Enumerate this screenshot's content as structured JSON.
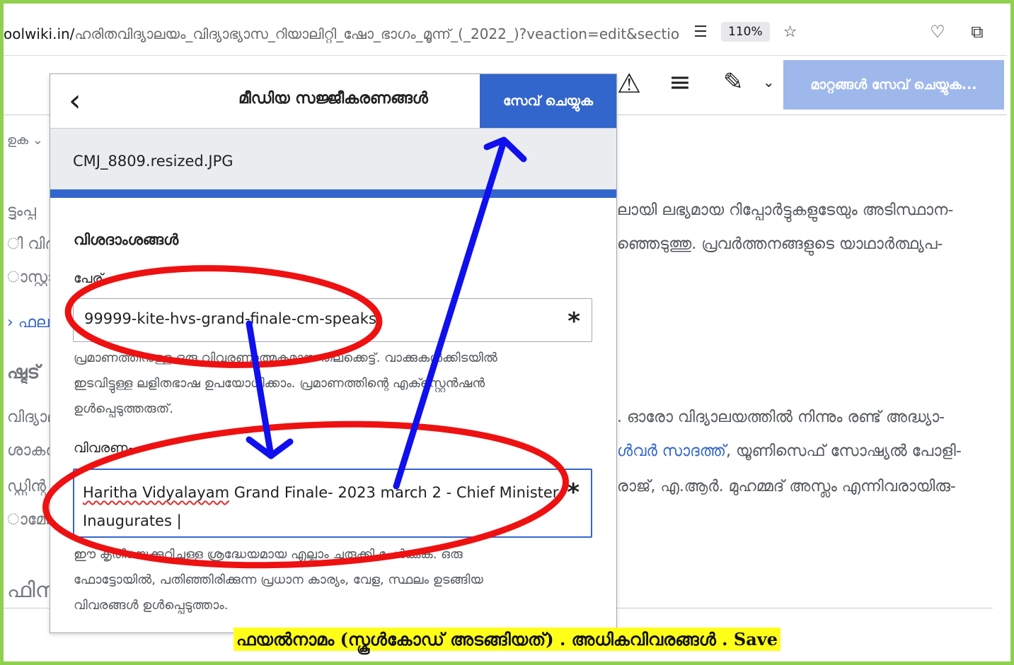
{
  "browser": {
    "url_domain": "oolwiki.in/",
    "url_path": "ഹരിതവിദ്യാലയം_വിദ്യാഭ്യാസ_റിയാലിറ്റി_ഷോ_ഭാഗം_മൂന്ന്_(_2022_)?veaction=edit&sectio",
    "zoom": "110%"
  },
  "toolbar": {
    "save_changes_label": "മാറ്റങ്ങൾ സേവ് ചെയ്യുക..."
  },
  "background": {
    "left_fragments": [
      "ഉക ⌄",
      "ട്ടുംപ്പ",
      "ി വിദ്യ",
      "ാസ്റ്റായ",
      "› ഫലട്ട",
      "ഷ്ടട്",
      "വിദ്യാല",
      "ശാകർ",
      "ഡ്ഡിന്റ",
      "ാമേല",
      "ഫിന"
    ],
    "right_line_1": "ലായി ലഭ്യമായ റിപ്പോർട്ടുകളുടേയും അടിസ്ഥാന-",
    "right_line_2": "ഞ്ഞെടുത്തു. പ്രവർത്തനങ്ങളുടെ യാഥാർത്ഥ്യപ-",
    "right_line_3": ". ഓരോ വിദ്യാലയത്തിൽ നിന്നും രണ്ട് അദ്ധ്യാ-",
    "right_line_4_link": "ൾവർ സാദത്ത്",
    "right_line_4_rest": ", യൂണിസെഫ് സോഷ്യൽ പോളി-",
    "right_line_5": "രാജ്, എ.ആർ. മുഹമ്മദ് അസ്ലം എന്നിവരായിരു-"
  },
  "dialog": {
    "title": "മീഡിയ സജ്ജീകരണങ്ങൾ",
    "save_label": "സേവ് ചെയ്യുക",
    "file_name": "CMJ_8809.resized.JPG",
    "section_title": "വിശദാംശങ്ങൾ",
    "name_label": "പേര്",
    "name_value": "99999-kite-hvs-grand-finale-cm-speaks",
    "name_help_1": "പ്രമാണത്തിനുള്ള ഒരു വിവരണാത്മകമായ തലക്കെട്ട്. വാക്കുകൾക്കിടയിൽ",
    "name_help_2": "ഇടവിട്ടുള്ള ലളിതഭാഷ ഉപയോഗിക്കാം. പ്രമാണത്തിന്റെ എക്സ്റ്റെൻഷൻ",
    "name_help_3": "ഉൾപ്പെടുത്തരുത്.",
    "desc_label": "വിവരണം",
    "desc_value_1_underlined": "Haritha Vidyalayam",
    "desc_value_1_rest": " Grand Finale- 2023 march 2 - Chief Minister",
    "desc_value_2": "Inaugurates |",
    "desc_help_1": "ഈ കൃതിയെക്കുറിച്ചുള്ള ശ്രദ്ധേയമായ എല്ലാം ചുരുക്കി ചേർക്കുക. ഒരു",
    "desc_help_2": "ഫോട്ടോയിൽ, പതിഞ്ഞിരിക്കുന്ന പ്രധാന കാര്യം, വേള, സ്ഥലം ഉടങ്ങിയ",
    "desc_help_3": "വിവരങ്ങൾ ഉൾപ്പെടുത്താം.",
    "required_mark": "*"
  },
  "caption": {
    "part1": "ഫയൽനാമം (സ്കൂൾകോഡ്  അടങ്ങിയത്) . അധികവിവരങ്ങൾ . Save"
  },
  "colors": {
    "accent_blue": "#3366cc",
    "annotation_red": "#ee1111",
    "annotation_blue": "#1010ee",
    "caption_highlight": "#ffff1a",
    "frame_green": "#8fd14f"
  }
}
